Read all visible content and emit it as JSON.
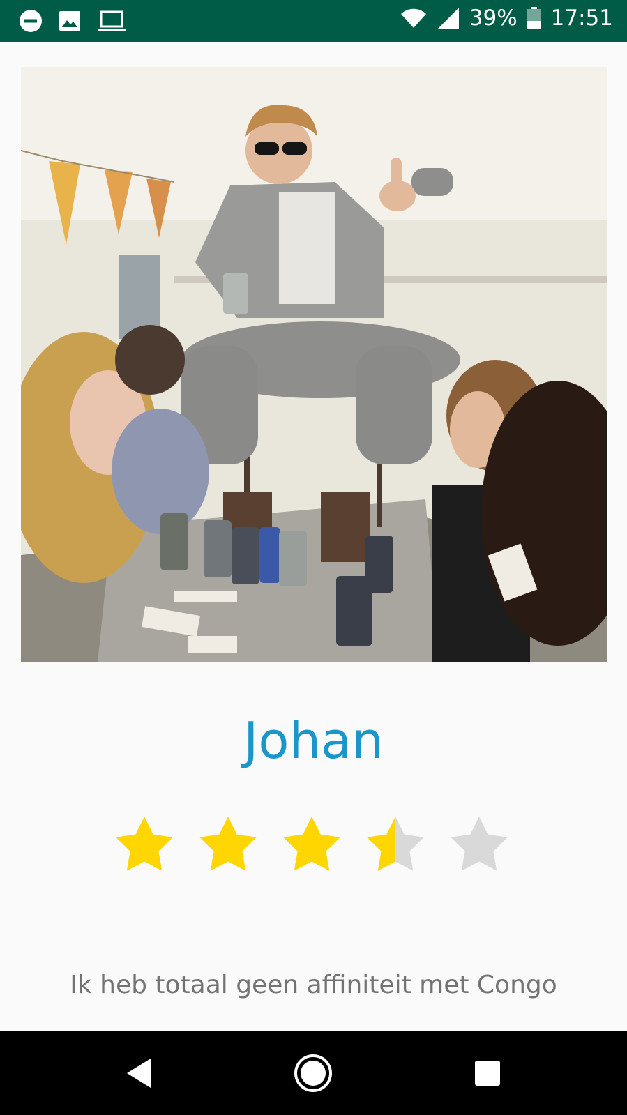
{
  "status_bar": {
    "battery_percent": "39%",
    "time": "17:51",
    "icons": [
      "do-not-disturb-icon",
      "gallery-icon",
      "laptop-icon",
      "wifi-icon",
      "cell-signal-icon",
      "battery-icon"
    ],
    "background": "#005c46"
  },
  "profile": {
    "name": "Johan",
    "rating": 3.5,
    "rating_max": 5,
    "quote": "Ik heb totaal geen affiniteit met Congo",
    "photo_icon": "party-photo"
  },
  "colors": {
    "name": "#1a96c8",
    "star_filled": "#ffd600",
    "star_empty": "#d9d9d9",
    "quote": "#737373"
  },
  "nav_bar": {
    "icons": [
      "back-icon",
      "home-icon",
      "recents-icon"
    ]
  }
}
